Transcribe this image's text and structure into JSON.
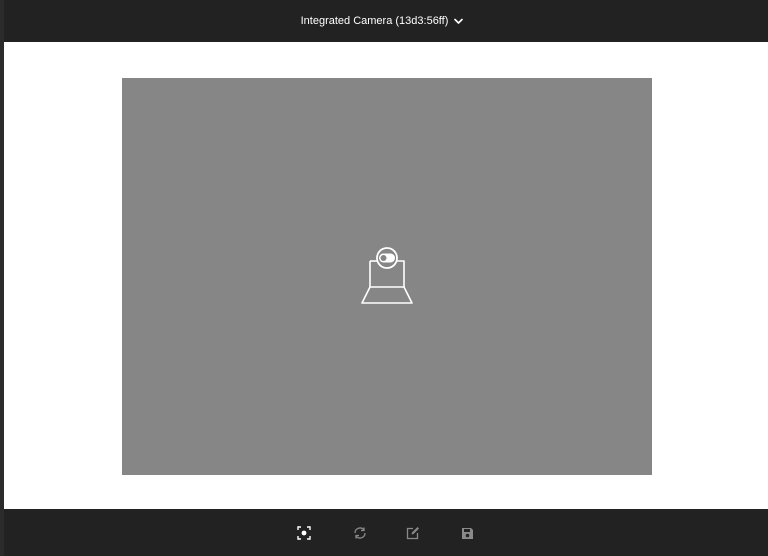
{
  "header": {
    "camera_label": "Integrated Camera (13d3:56ff)",
    "dropdown_icon": "chevron-down-icon"
  },
  "preview": {
    "placeholder_icon": "webcam-off-icon",
    "background": "#868686"
  },
  "toolbar": {
    "items": [
      {
        "icon": "capture-icon",
        "enabled": true
      },
      {
        "icon": "switch-camera-icon",
        "enabled": false
      },
      {
        "icon": "edit-icon",
        "enabled": false
      },
      {
        "icon": "save-icon",
        "enabled": false
      }
    ]
  },
  "colors": {
    "bar_background": "#222222",
    "preview_background": "#868686",
    "icon_enabled": "#ffffff",
    "icon_disabled": "#8a8a8a"
  }
}
